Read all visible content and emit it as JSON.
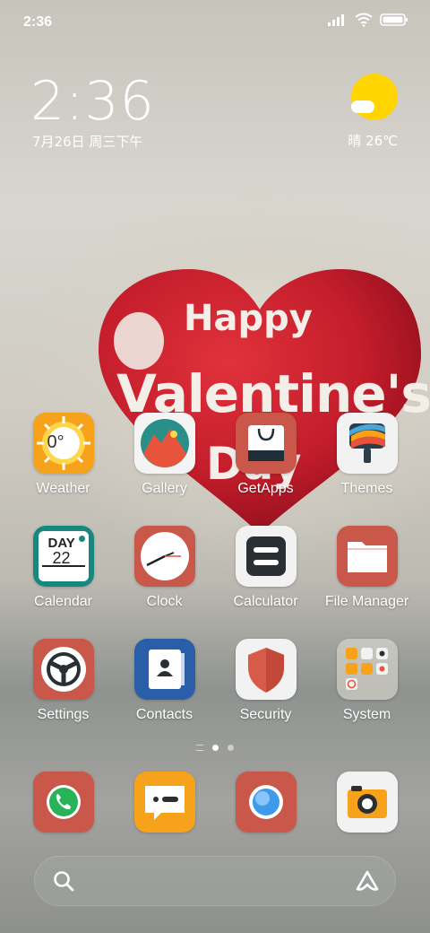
{
  "status_bar": {
    "time": "2:36"
  },
  "clock_widget": {
    "time": "2:36",
    "date": "7月26日 周三下午"
  },
  "weather_widget": {
    "text": "晴 26℃",
    "icon": "sun-cloud-icon"
  },
  "wallpaper": {
    "line1": "Happy",
    "line2": "Valentine's",
    "line3": "Day"
  },
  "apps": [
    {
      "label": "Weather",
      "icon": "weather-icon",
      "badge": "0°"
    },
    {
      "label": "Gallery",
      "icon": "gallery-icon"
    },
    {
      "label": "GetApps",
      "icon": "getapps-icon"
    },
    {
      "label": "Themes",
      "icon": "themes-icon"
    },
    {
      "label": "Calendar",
      "icon": "calendar-icon",
      "day_label": "DAY",
      "day_number": "22"
    },
    {
      "label": "Clock",
      "icon": "clock-icon"
    },
    {
      "label": "Calculator",
      "icon": "calculator-icon"
    },
    {
      "label": "File Manager",
      "icon": "folder-icon"
    },
    {
      "label": "Settings",
      "icon": "settings-icon"
    },
    {
      "label": "Contacts",
      "icon": "contacts-icon"
    },
    {
      "label": "Security",
      "icon": "shield-icon"
    },
    {
      "label": "System",
      "icon": "folder-grid-icon"
    }
  ],
  "dock": [
    {
      "icon": "phone-icon"
    },
    {
      "icon": "messages-icon"
    },
    {
      "icon": "browser-icon"
    },
    {
      "icon": "camera-icon"
    }
  ],
  "page_indicator": {
    "pages": 2,
    "current": 1
  },
  "search_bar": {
    "left_icon": "search-icon",
    "right_icon": "assistant-icon"
  },
  "colors": {
    "weather_bg": "#f7a21b",
    "gallery_bg": "#f4f4f4",
    "getapps_bg": "#c9584a",
    "themes_bg": "#f2f2f2",
    "calendar_bg": "#18887e",
    "clock_bg": "#c9584a",
    "calculator_bg": "#f2f2f2",
    "filemanager_bg": "#c9584a",
    "settings_bg": "#c9584a",
    "contacts_bg": "#2b5ea8",
    "security_bg": "#f2f2f2",
    "phone_bg": "#c9584a",
    "messages_bg": "#f7a21b",
    "browser_bg": "#c9584a",
    "camera_bg": "#f2f2f2"
  }
}
